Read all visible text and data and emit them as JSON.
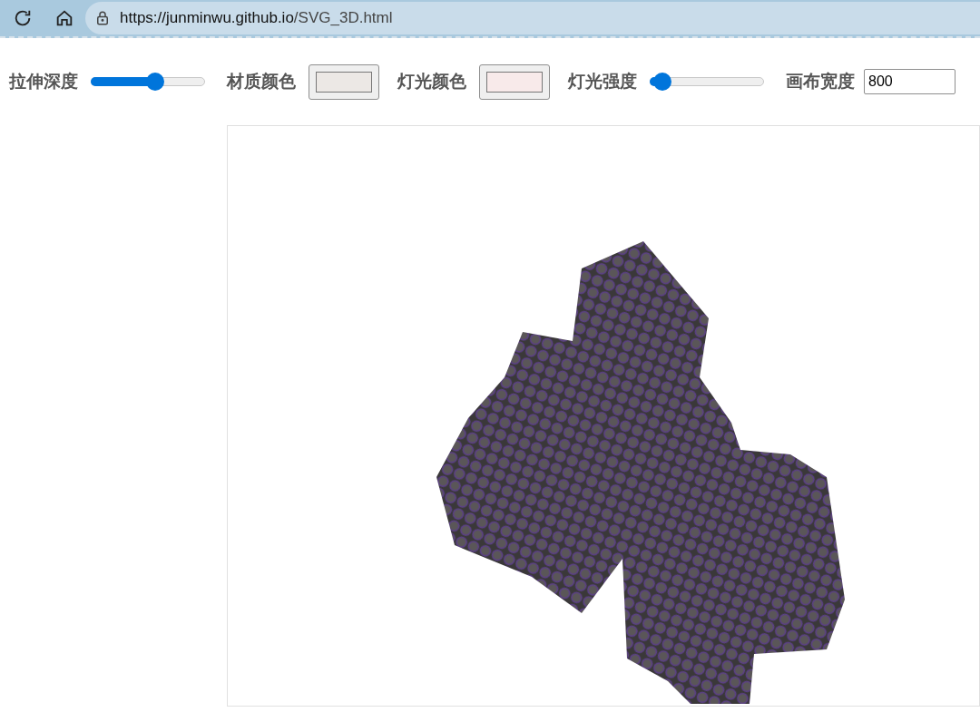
{
  "browser": {
    "url_host": "https://junminwu.github.io",
    "url_path": "/SVG_3D.html"
  },
  "controls": [
    {
      "kind": "slider",
      "label": "拉伸深度",
      "level": 0.56
    },
    {
      "kind": "color",
      "label": "材质颜色",
      "color": "#ece8e5"
    },
    {
      "kind": "color",
      "label": "灯光颜色",
      "color": "#f8eaea"
    },
    {
      "kind": "slider",
      "label": "灯光强度",
      "level": 0.11
    },
    {
      "kind": "number",
      "label": "画布宽度",
      "value": "800"
    }
  ]
}
